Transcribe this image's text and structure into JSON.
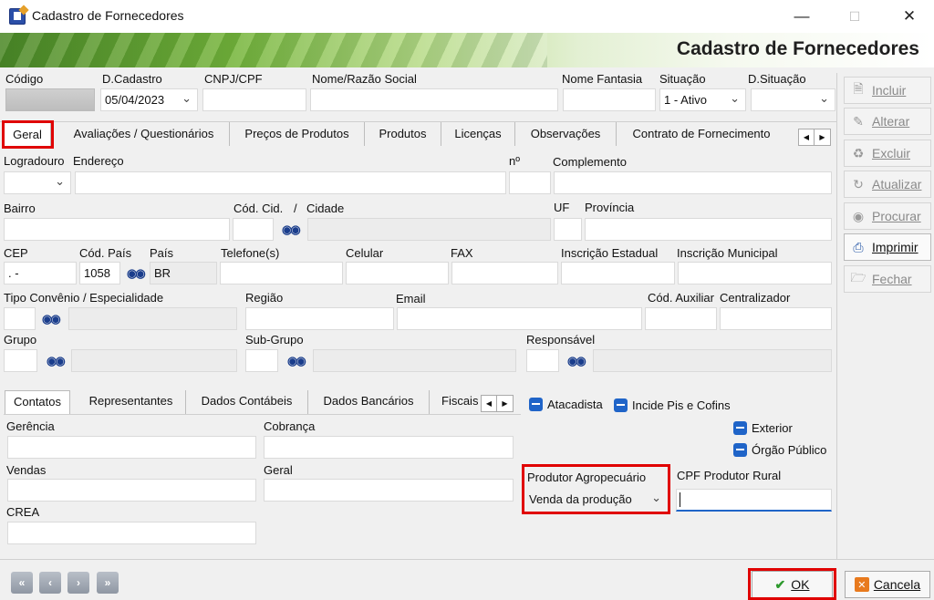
{
  "window": {
    "title": "Cadastro de Fornecedores",
    "banner_title": "Cadastro de Fornecedores"
  },
  "header": {
    "codigo": {
      "label": "Código",
      "value": ""
    },
    "d_cadastro": {
      "label": "D.Cadastro",
      "value": "05/04/2023"
    },
    "cnpj": {
      "label": "CNPJ/CPF",
      "value": ""
    },
    "nome": {
      "label": "Nome/Razão Social",
      "value": ""
    },
    "fantasia": {
      "label": "Nome Fantasia",
      "value": ""
    },
    "situacao": {
      "label": "Situação",
      "value": "1 - Ativo"
    },
    "d_situacao": {
      "label": "D.Situação",
      "value": ""
    }
  },
  "tabs": [
    "Geral",
    "Avaliações / Questionários",
    "Preços de Produtos",
    "Produtos",
    "Licenças",
    "Observações",
    "Contrato de Fornecimento"
  ],
  "geral": {
    "logradouro": "Logradouro",
    "endereco": "Endereço",
    "numero": "nº",
    "complemento": "Complemento",
    "bairro": "Bairro",
    "cod_cid": "Cód. Cid.",
    "cidade_sep": "/",
    "cidade": "Cidade",
    "uf": "UF",
    "provincia": "Província",
    "cep": "CEP",
    "cep_value": ".  -",
    "cod_pais": "Cód. País",
    "cod_pais_value": "1058",
    "pais": "País",
    "pais_value": "BR",
    "telefone": "Telefone(s)",
    "celular": "Celular",
    "fax": "FAX",
    "insc_estadual": "Inscrição Estadual",
    "insc_municipal": "Inscrição Municipal",
    "tipo_convenio": "Tipo Convênio / Especialidade",
    "regiao": "Região",
    "email": "Email",
    "cod_auxiliar": "Cód. Auxiliar",
    "centralizador": "Centralizador",
    "grupo": "Grupo",
    "sub_grupo": "Sub-Grupo",
    "responsavel": "Responsável"
  },
  "subtabs": [
    "Contatos",
    "Representantes",
    "Dados Contábeis",
    "Dados Bancários",
    "Fiscais"
  ],
  "checks": {
    "atacadista": "Atacadista",
    "incide": "Incide Pis e Cofins",
    "exterior": "Exterior",
    "orgao": "Órgão Público"
  },
  "contatos": {
    "gerencia": "Gerência",
    "cobranca": "Cobrança",
    "vendas": "Vendas",
    "geral": "Geral",
    "crea": "CREA"
  },
  "produtor": {
    "label": "Produtor Agropecuário",
    "value": "Venda  da produção",
    "cpf_label": "CPF Produtor Rural",
    "cpf_value": ""
  },
  "sidebar": [
    "Incluir",
    "Alterar",
    "Excluir",
    "Atualizar",
    "Procurar",
    "Imprimir",
    "Fechar"
  ],
  "footer": {
    "ok": "OK",
    "cancel": "Cancela"
  },
  "colors": {
    "accent": "#1f64c8",
    "highlight": "#e00000",
    "ok_green": "#2e9a2e"
  }
}
